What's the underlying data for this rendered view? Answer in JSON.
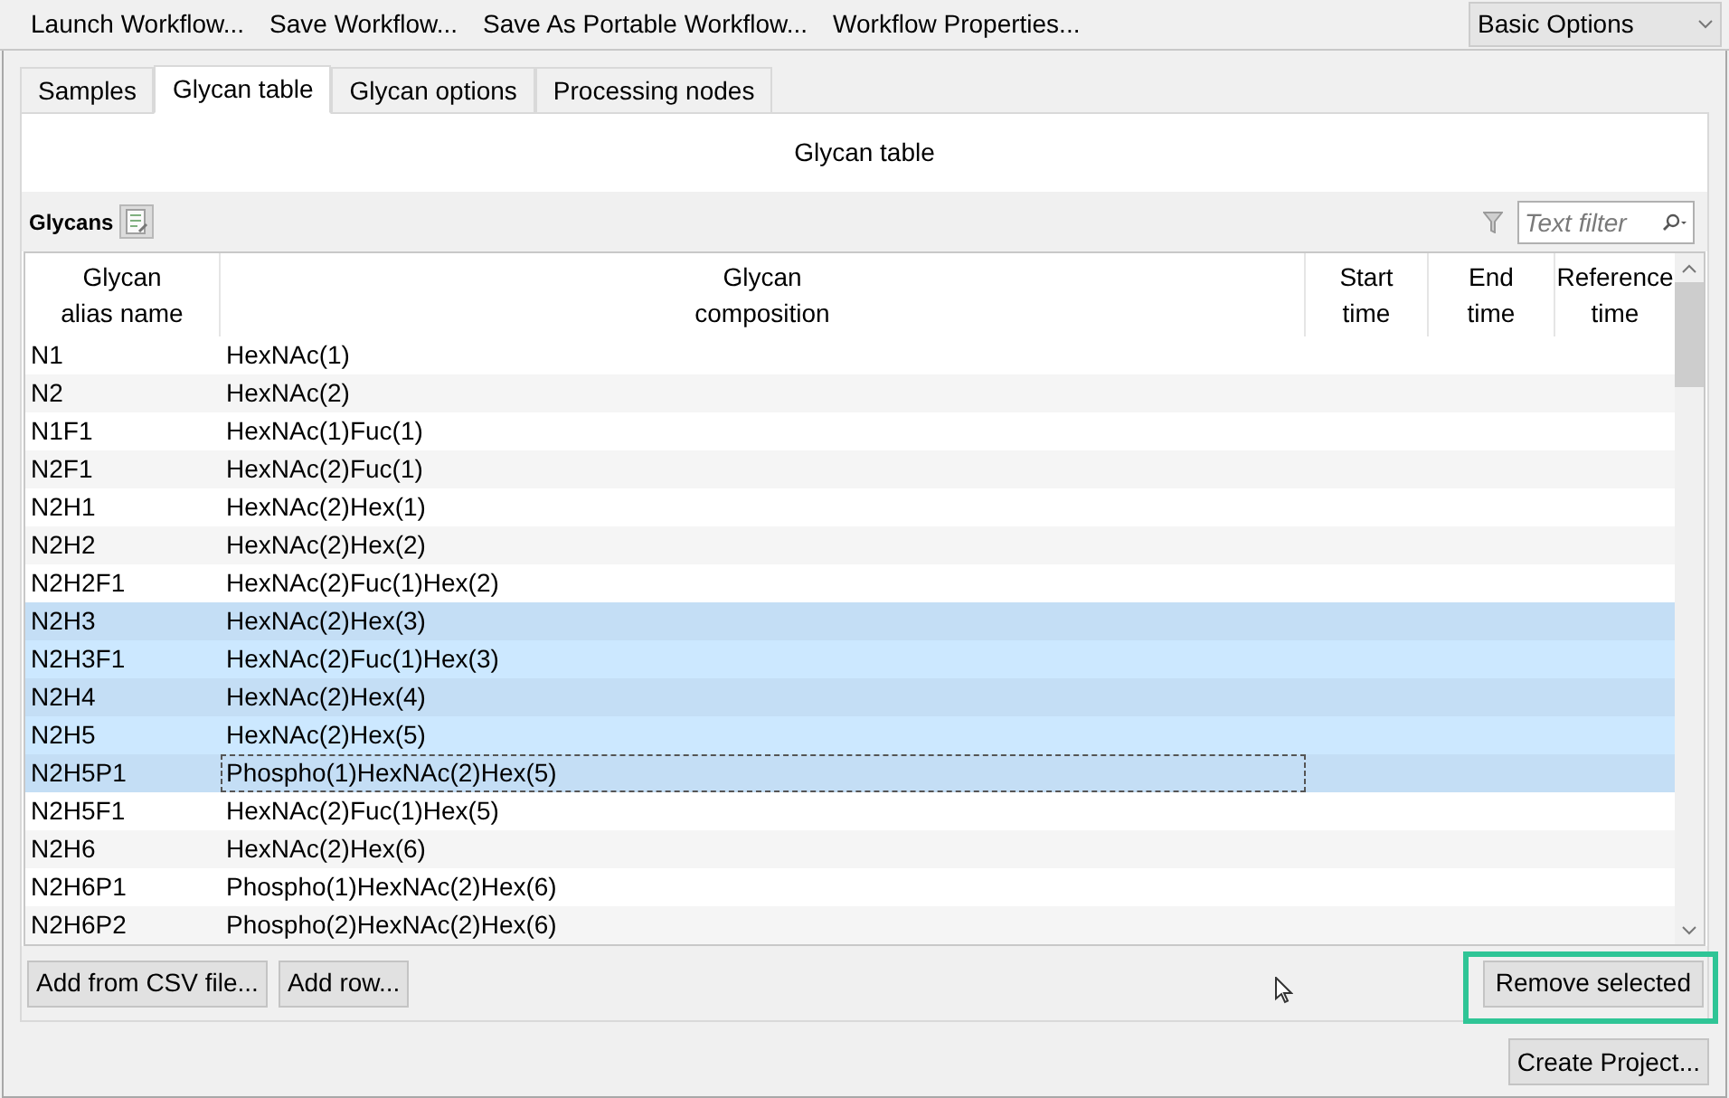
{
  "toolbar": {
    "actions": [
      "Launch Workflow...",
      "Save Workflow...",
      "Save As Portable Workflow...",
      "Workflow Properties..."
    ],
    "mode_select": {
      "value": "Basic Options"
    }
  },
  "tabs": [
    {
      "label": "Samples",
      "selected": false
    },
    {
      "label": "Glycan table",
      "selected": true
    },
    {
      "label": "Glycan options",
      "selected": false
    },
    {
      "label": "Processing nodes",
      "selected": false
    }
  ],
  "panel": {
    "title": "Glycan table",
    "section_label": "Glycans",
    "filter": {
      "placeholder": "Text filter"
    }
  },
  "table": {
    "columns": [
      "Glycan\nalias name",
      "Glycan\ncomposition",
      "Start\ntime",
      "End\ntime",
      "Reference\ntime"
    ],
    "rows": [
      {
        "alias": "N1",
        "composition": "HexNAc(1)",
        "selected": false,
        "focused": false
      },
      {
        "alias": "N2",
        "composition": "HexNAc(2)",
        "selected": false,
        "focused": false
      },
      {
        "alias": "N1F1",
        "composition": "HexNAc(1)Fuc(1)",
        "selected": false,
        "focused": false
      },
      {
        "alias": "N2F1",
        "composition": "HexNAc(2)Fuc(1)",
        "selected": false,
        "focused": false
      },
      {
        "alias": "N2H1",
        "composition": "HexNAc(2)Hex(1)",
        "selected": false,
        "focused": false
      },
      {
        "alias": "N2H2",
        "composition": "HexNAc(2)Hex(2)",
        "selected": false,
        "focused": false
      },
      {
        "alias": "N2H2F1",
        "composition": "HexNAc(2)Fuc(1)Hex(2)",
        "selected": false,
        "focused": false
      },
      {
        "alias": "N2H3",
        "composition": "HexNAc(2)Hex(3)",
        "selected": true,
        "focused": false
      },
      {
        "alias": "N2H3F1",
        "composition": "HexNAc(2)Fuc(1)Hex(3)",
        "selected": true,
        "focused": false
      },
      {
        "alias": "N2H4",
        "composition": "HexNAc(2)Hex(4)",
        "selected": true,
        "focused": false
      },
      {
        "alias": "N2H5",
        "composition": "HexNAc(2)Hex(5)",
        "selected": true,
        "focused": false
      },
      {
        "alias": "N2H5P1",
        "composition": "Phospho(1)HexNAc(2)Hex(5)",
        "selected": true,
        "focused": true
      },
      {
        "alias": "N2H5F1",
        "composition": "HexNAc(2)Fuc(1)Hex(5)",
        "selected": false,
        "focused": false
      },
      {
        "alias": "N2H6",
        "composition": "HexNAc(2)Hex(6)",
        "selected": false,
        "focused": false
      },
      {
        "alias": "N2H6P1",
        "composition": "Phospho(1)HexNAc(2)Hex(6)",
        "selected": false,
        "focused": false
      },
      {
        "alias": "N2H6P2",
        "composition": "Phospho(2)HexNAc(2)Hex(6)",
        "selected": false,
        "focused": false
      }
    ]
  },
  "bottom_bar": {
    "left_buttons": [
      "Add from CSV file...",
      "Add row..."
    ],
    "remove": {
      "label": "Remove selected",
      "highlighted": true
    }
  },
  "footer_button": "Create Project..."
}
